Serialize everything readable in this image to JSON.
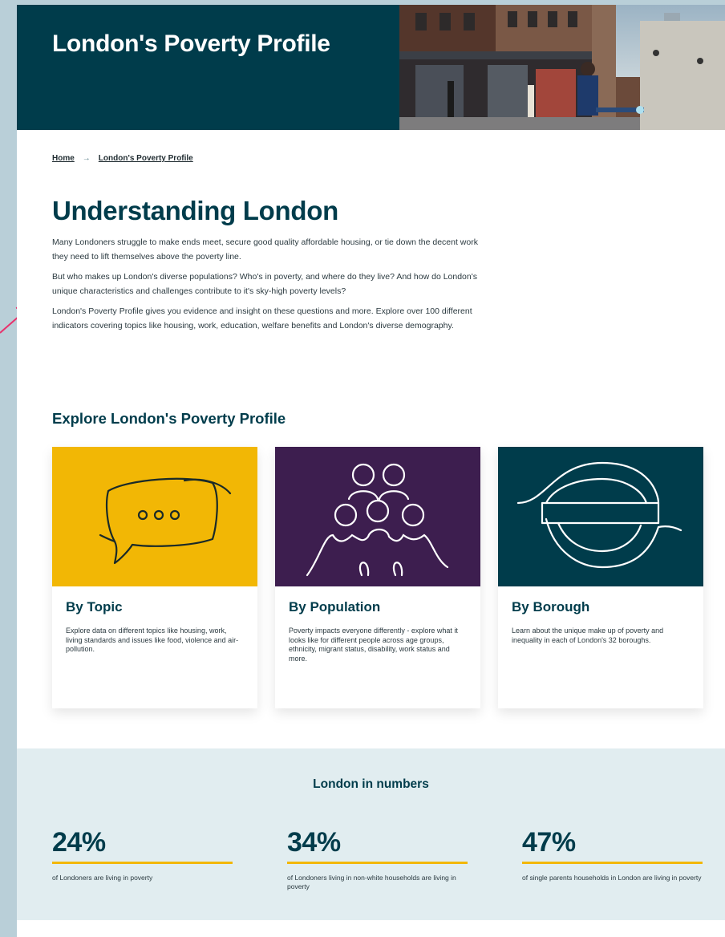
{
  "hero": {
    "title": "London's Poverty Profile"
  },
  "breadcrumb": {
    "home": "Home",
    "separator": "→",
    "current": "London's Poverty Profile"
  },
  "main": {
    "title": "Understanding London",
    "paragraphs": [
      "Many Londoners struggle to make ends meet, secure good quality affordable housing, or tie down the decent work they need to lift themselves above the poverty line.",
      "But who makes up London's diverse populations? Who's in poverty, and where do they live? And how do London's unique characteristics and challenges contribute to it's sky-high poverty levels?",
      "London's Poverty Profile gives you evidence and insight on these questions and more. Explore over 100 different indicators covering topics like housing, work, education, welfare benefits and London's diverse demography."
    ]
  },
  "explore": {
    "title": "Explore London's Poverty Profile",
    "cards": [
      {
        "title": "By Topic",
        "text": "Explore data on different topics like housing, work, living standards and issues like food, violence and air-pollution.",
        "bg": "#f2b705",
        "icon": "speech-bubble-icon"
      },
      {
        "title": "By Population",
        "text": "Poverty impacts everyone differently - explore what it looks like for different people across age groups, ethnicity, migrant status, disability, work status and more.",
        "bg": "#3d1e4f",
        "icon": "people-group-icon"
      },
      {
        "title": "By Borough",
        "text": "Learn about the unique make up of poverty and inequality in each of London's 32 boroughs.",
        "bg": "#003c4b",
        "icon": "london-roundel-icon"
      }
    ]
  },
  "numbers": {
    "title": "London in numbers",
    "stats": [
      {
        "value": "24%",
        "text": "of Londoners are living in poverty"
      },
      {
        "value": "34%",
        "text": "of Londoners living in non-white households are living in poverty"
      },
      {
        "value": "47%",
        "text": "of single parents households in London are living in poverty"
      }
    ]
  },
  "colors": {
    "brand": "#003c4b",
    "accent": "#f2b705",
    "purple": "#3d1e4f",
    "numbers_bg": "#e1edf0",
    "annotation": "#e8336d"
  }
}
